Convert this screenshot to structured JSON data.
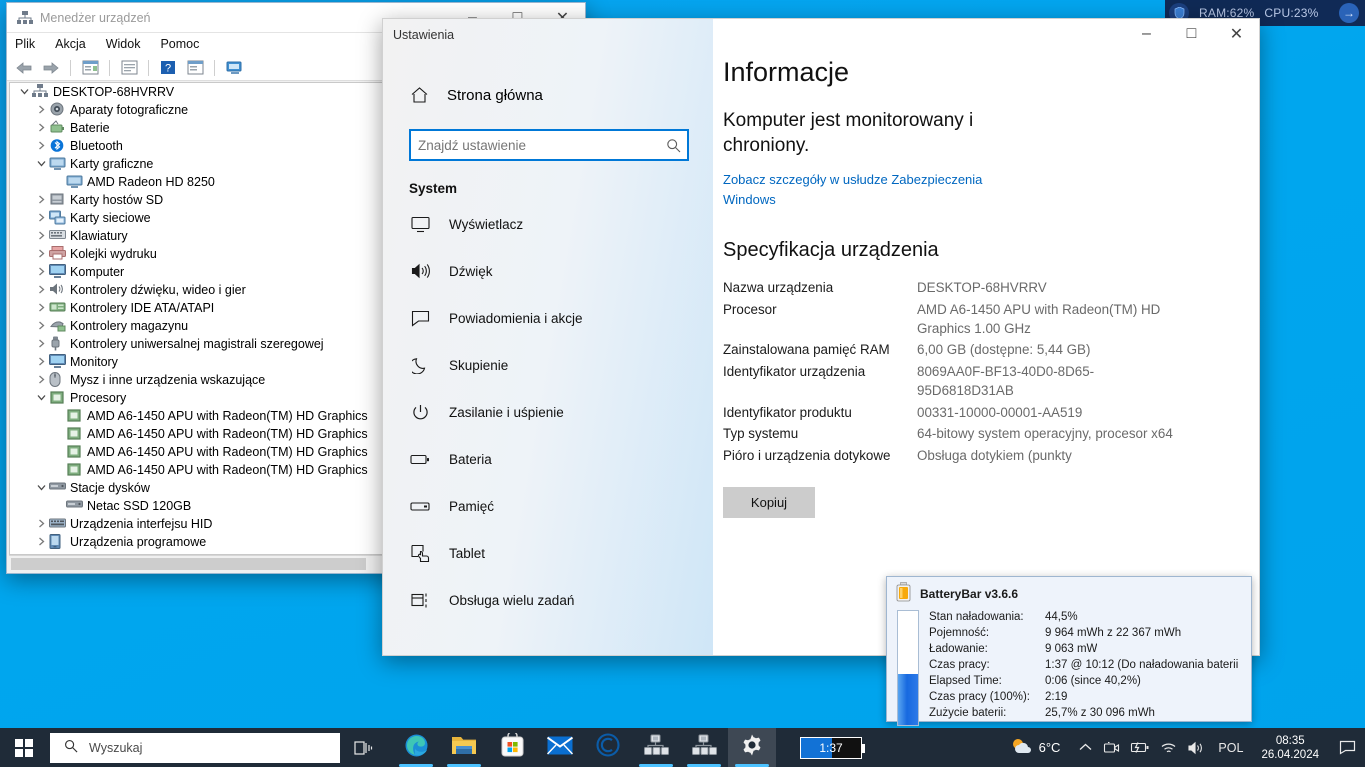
{
  "perf_overlay": {
    "ram_label": "RAM:62%",
    "cpu_label": "CPU:23%",
    "bg_color": "#102a56"
  },
  "device_manager": {
    "title": "Menedżer urządzeń",
    "menu": [
      "Plik",
      "Akcja",
      "Widok",
      "Pomoc"
    ],
    "toolbar_icons": [
      "back-arrow-icon",
      "forward-arrow-icon",
      "properties-icon",
      "show-hidden-icon",
      "help-icon",
      "scan-hardware-icon",
      "remote-icon"
    ],
    "tree": [
      {
        "label": "DESKTOP-68HVRRV",
        "depth": 0,
        "chev": "expanded",
        "icon": "computer-icon"
      },
      {
        "label": "Aparaty fotograficzne",
        "depth": 1,
        "chev": "collapsed",
        "icon": "camera-icon"
      },
      {
        "label": "Baterie",
        "depth": 1,
        "chev": "collapsed",
        "icon": "battery-icon"
      },
      {
        "label": "Bluetooth",
        "depth": 1,
        "chev": "collapsed",
        "icon": "bluetooth-icon"
      },
      {
        "label": "Karty graficzne",
        "depth": 1,
        "chev": "expanded",
        "icon": "display-adapter-icon"
      },
      {
        "label": "AMD Radeon HD 8250",
        "depth": 2,
        "chev": "none",
        "icon": "display-adapter-icon"
      },
      {
        "label": "Karty hostów SD",
        "depth": 1,
        "chev": "collapsed",
        "icon": "sd-host-icon"
      },
      {
        "label": "Karty sieciowe",
        "depth": 1,
        "chev": "collapsed",
        "icon": "network-icon"
      },
      {
        "label": "Klawiatury",
        "depth": 1,
        "chev": "collapsed",
        "icon": "keyboard-icon"
      },
      {
        "label": "Kolejki wydruku",
        "depth": 1,
        "chev": "collapsed",
        "icon": "printer-icon"
      },
      {
        "label": "Komputer",
        "depth": 1,
        "chev": "collapsed",
        "icon": "monitor-icon"
      },
      {
        "label": "Kontrolery dźwięku, wideo i gier",
        "depth": 1,
        "chev": "collapsed",
        "icon": "sound-icon"
      },
      {
        "label": "Kontrolery IDE ATA/ATAPI",
        "depth": 1,
        "chev": "collapsed",
        "icon": "ide-icon"
      },
      {
        "label": "Kontrolery magazynu",
        "depth": 1,
        "chev": "collapsed",
        "icon": "storage-icon"
      },
      {
        "label": "Kontrolery uniwersalnej magistrali szeregowej",
        "depth": 1,
        "chev": "collapsed",
        "icon": "usb-icon"
      },
      {
        "label": "Monitory",
        "depth": 1,
        "chev": "collapsed",
        "icon": "monitor-icon"
      },
      {
        "label": "Mysz i inne urządzenia wskazujące",
        "depth": 1,
        "chev": "collapsed",
        "icon": "mouse-icon"
      },
      {
        "label": "Procesory",
        "depth": 1,
        "chev": "expanded",
        "icon": "processor-icon"
      },
      {
        "label": "AMD A6-1450 APU with Radeon(TM) HD Graphics",
        "depth": 2,
        "chev": "none",
        "icon": "processor-icon"
      },
      {
        "label": "AMD A6-1450 APU with Radeon(TM) HD Graphics",
        "depth": 2,
        "chev": "none",
        "icon": "processor-icon"
      },
      {
        "label": "AMD A6-1450 APU with Radeon(TM) HD Graphics",
        "depth": 2,
        "chev": "none",
        "icon": "processor-icon"
      },
      {
        "label": "AMD A6-1450 APU with Radeon(TM) HD Graphics",
        "depth": 2,
        "chev": "none",
        "icon": "processor-icon"
      },
      {
        "label": "Stacje dysków",
        "depth": 1,
        "chev": "expanded",
        "icon": "disk-icon"
      },
      {
        "label": "Netac SSD 120GB",
        "depth": 2,
        "chev": "none",
        "icon": "disk-icon"
      },
      {
        "label": "Urządzenia interfejsu HID",
        "depth": 1,
        "chev": "collapsed",
        "icon": "hid-icon"
      },
      {
        "label": "Urządzenia programowe",
        "depth": 1,
        "chev": "collapsed",
        "icon": "software-device-icon"
      }
    ]
  },
  "settings": {
    "title": "Ustawienia",
    "home_label": "Strona główna",
    "search_placeholder": "Znajdź ustawienie",
    "search_value": "",
    "section_label": "System",
    "nav_items": [
      {
        "label": "Wyświetlacz",
        "icon": "display-icon"
      },
      {
        "label": "Dźwięk",
        "icon": "sound-icon"
      },
      {
        "label": "Powiadomienia i akcje",
        "icon": "notifications-icon"
      },
      {
        "label": "Skupienie",
        "icon": "focus-moon-icon"
      },
      {
        "label": "Zasilanie i uśpienie",
        "icon": "power-icon"
      },
      {
        "label": "Bateria",
        "icon": "battery-icon"
      },
      {
        "label": "Pamięć",
        "icon": "storage-icon"
      },
      {
        "label": "Tablet",
        "icon": "tablet-icon"
      },
      {
        "label": "Obsługa wielu zadań",
        "icon": "multitasking-icon"
      }
    ],
    "page": {
      "title": "Informacje",
      "subtitle": "Komputer jest monitorowany i chroniony.",
      "link": "Zobacz szczegóły w usłudze Zabezpieczenia Windows",
      "spec_heading": "Specyfikacja urządzenia",
      "specs": [
        {
          "key": "Nazwa urządzenia",
          "value": "DESKTOP-68HVRRV"
        },
        {
          "key": "Procesor",
          "value": "AMD A6-1450 APU with Radeon(TM) HD Graphics    1.00 GHz"
        },
        {
          "key": "Zainstalowana pamięć RAM",
          "value": "6,00 GB (dostępne: 5,44 GB)"
        },
        {
          "key": "Identyfikator urządzenia",
          "value": "8069AA0F-BF13-40D0-8D65-95D6818D31AB"
        },
        {
          "key": "Identyfikator produktu",
          "value": "00331-10000-00001-AA519"
        },
        {
          "key": "Typ systemu",
          "value": "64-bitowy system operacyjny, procesor x64"
        },
        {
          "key": "Pióro i urządzenia dotykowe",
          "value": "Obsługa dotykiem (punkty"
        }
      ],
      "copy_button": "Kopiuj"
    }
  },
  "batterybar_tooltip": {
    "title": "BatteryBar v3.6.6",
    "charge_percent": 44.5,
    "rows": [
      {
        "key": "Stan naładowania:",
        "value": "44,5%"
      },
      {
        "key": "Pojemność:",
        "value": "9 964 mWh z 22 367 mWh"
      },
      {
        "key": "Ładowanie:",
        "value": "9 063 mW"
      },
      {
        "key": "Czas pracy:",
        "value": "1:37 @ 10:12 (Do naładowania baterii"
      },
      {
        "key": "Elapsed Time:",
        "value": "0:06 (since 40,2%)"
      },
      {
        "key": "Czas pracy (100%):",
        "value": "2:19"
      },
      {
        "key": "Zużycie baterii:",
        "value": "25,7% z 30 096 mWh"
      }
    ]
  },
  "taskbar": {
    "start_icon": "windows-logo-icon",
    "search_placeholder": "Wyszukaj",
    "taskview_icon": "task-view-icon",
    "apps": [
      {
        "name": "microsoft-edge",
        "icon": "edge-icon",
        "running": true,
        "active": false
      },
      {
        "name": "file-explorer",
        "icon": "folder-icon",
        "running": true,
        "active": false
      },
      {
        "name": "microsoft-store",
        "icon": "store-icon",
        "running": false,
        "active": false
      },
      {
        "name": "mail",
        "icon": "mail-icon",
        "running": false,
        "active": false
      },
      {
        "name": "ccleaner",
        "icon": "ccleaner-icon",
        "running": false,
        "active": false
      },
      {
        "name": "device-manager-1",
        "icon": "device-manager-icon",
        "running": true,
        "active": false
      },
      {
        "name": "device-manager-2",
        "icon": "device-manager-icon",
        "running": true,
        "active": false
      },
      {
        "name": "settings",
        "icon": "gear-icon",
        "running": true,
        "active": true
      }
    ],
    "batterybar_widget": {
      "label": "1:37",
      "fill_percent": 52
    },
    "weather": {
      "temp": "6°C",
      "icon": "partly-sunny-icon"
    },
    "tray_icons": [
      "chevron-up-icon",
      "screen-capture-icon",
      "battery-charging-icon",
      "wifi-icon",
      "volume-icon"
    ],
    "language": "POL",
    "clock_time": "08:35",
    "clock_date": "26.04.2024",
    "action_center_icon": "action-center-icon"
  },
  "window_buttons": {
    "minimize": "–",
    "maximize": "□",
    "close": "✕"
  },
  "colors": {
    "desktop": "#00a6ee",
    "accent": "#0078d7",
    "taskbar": "#1f2b38",
    "link": "#0067c0"
  }
}
